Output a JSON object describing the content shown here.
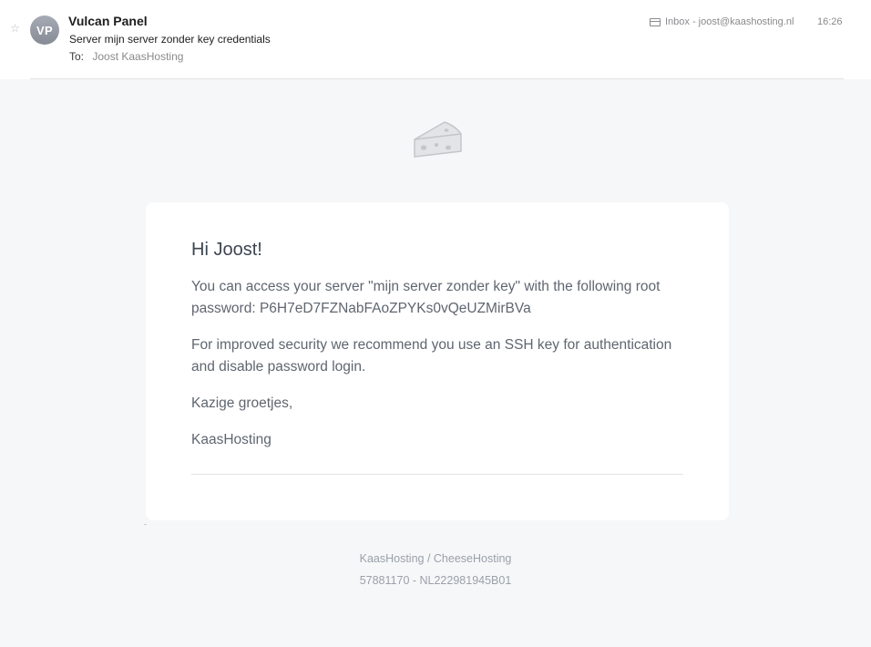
{
  "header": {
    "sender_initials": "VP",
    "sender_name": "Vulcan Panel",
    "subject": "Server mijn server zonder key credentials",
    "to_label": "To:",
    "to_value": "Joost KaasHosting",
    "mailbox": "Inbox - joost@kaashosting.nl",
    "time": "16:26",
    "icons": {
      "flag": "star-icon",
      "mailbox": "inbox-icon"
    }
  },
  "email": {
    "logo_icon": "cheese-icon",
    "greeting": "Hi Joost!",
    "paragraph_1": "You can access your server \"mijn server zonder key\" with the following root password: P6H7eD7FZNabFAoZPYKs0vQeUZMirBVa",
    "paragraph_2": "For improved security we recommend you use an SSH key for authentication and disable password login.",
    "signoff": "Kazige groetjes,",
    "signature": "KaasHosting"
  },
  "footer": {
    "company": "KaasHosting / CheeseHosting",
    "registration": "57881170 - NL222981945B01"
  },
  "colors": {
    "avatar": "#8f949d",
    "body_background": "#f6f7f8",
    "text_muted": "#5f6670"
  }
}
